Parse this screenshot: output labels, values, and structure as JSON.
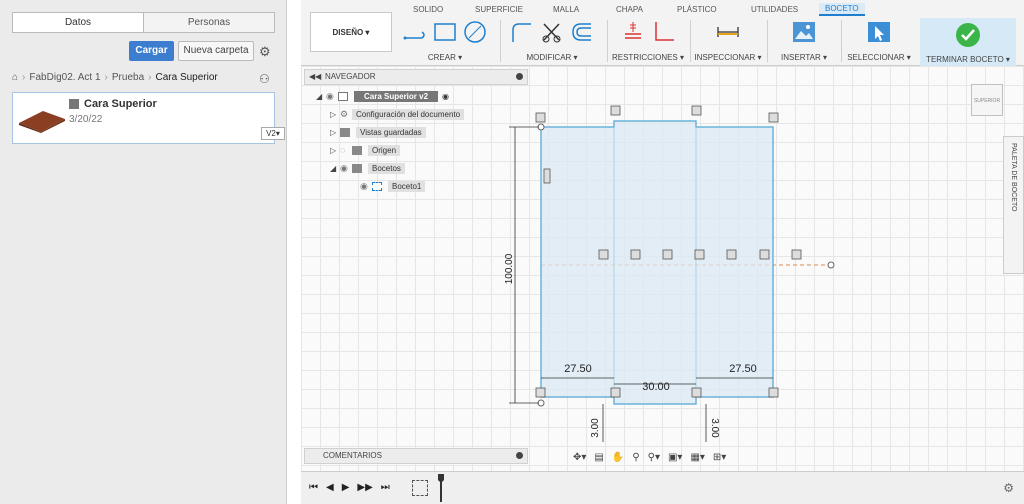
{
  "left_panel": {
    "tabs": [
      "Datos",
      "Personas"
    ],
    "upload_label": "Cargar",
    "new_folder_label": "Nueva carpeta",
    "breadcrumb": [
      "FabDig02. Act 1",
      "Prueba",
      "Cara Superior"
    ],
    "file": {
      "name": "Cara Superior",
      "date": "3/20/22",
      "version": "V2"
    }
  },
  "toolbar": {
    "tabs": [
      "SOLIDO",
      "SUPERFICIE",
      "MALLA",
      "CHAPA",
      "PLÁSTICO",
      "UTILIDADES",
      "BOCETO"
    ],
    "active_tab": "BOCETO",
    "workspace_label": "DISEÑO ▾",
    "groups": [
      "CREAR ▾",
      "MODIFICAR ▾",
      "RESTRICCIONES ▾",
      "INSPECCIONAR ▾",
      "INSERTAR ▾",
      "SELECCIONAR ▾",
      "TERMINAR BOCETO ▾"
    ],
    "accent": "#1d7fce",
    "finish_color": "#3bb44a"
  },
  "browser": {
    "navigator_label": "NAVEGADOR",
    "root": "Cara Superior v2",
    "items": [
      "Configuración del documento",
      "Vistas guardadas",
      "Origen",
      "Bocetos",
      "Boceto1"
    ],
    "comments_label": "COMENTARIOS"
  },
  "canvas": {
    "palette_label": "PALETA DE BOCETO",
    "viewcube_label": "SUPERIOR",
    "dimensions": {
      "height": "100.00",
      "left_offset": "27.50",
      "right_offset": "27.50",
      "slot_width": "30.00",
      "left_depth": "3.00",
      "right_depth": "3.00"
    },
    "sketch_fill": "#dbe8f3",
    "sketch_stroke": "#6bb3d9"
  }
}
